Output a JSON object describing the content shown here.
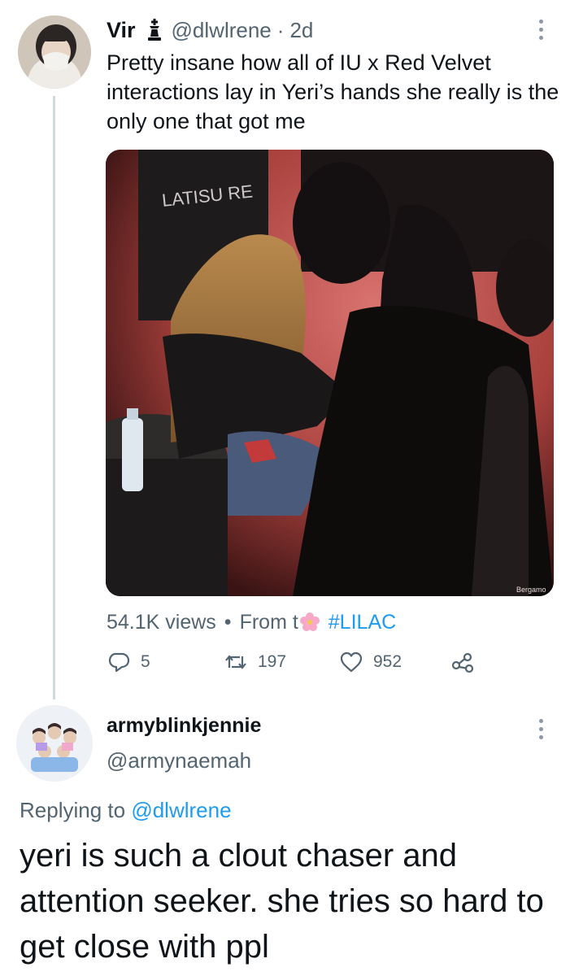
{
  "tweet": {
    "author_name": "Vir",
    "badge_icon": "chess-king-icon",
    "handle": "@dlwlrene",
    "separator": "·",
    "time": "2d",
    "text": "Pretty insane how all of IU x Red Velvet interactions lay in Yeri’s hands she really is the only one that got me",
    "media_watermark": "Bergamo",
    "views": "54.1K views",
    "views_separator": "•",
    "from_text": "From t",
    "from_emoji": "cherry-blossom-icon",
    "hashtag": "#LILAC",
    "actions": {
      "replies": "5",
      "retweets": "197",
      "likes": "952"
    }
  },
  "reply": {
    "author_name": "armyblinkjennie",
    "handle": "@armynaemah",
    "replying_prefix": "Replying to",
    "replying_to": "@dlwlrene",
    "text": "yeri is such a clout chaser and attention seeker. she tries so hard to get close with ppl"
  },
  "colors": {
    "text_primary": "#0f1419",
    "text_secondary": "#536471",
    "link": "#1d9bf0",
    "thread_line": "#cfd9de"
  }
}
